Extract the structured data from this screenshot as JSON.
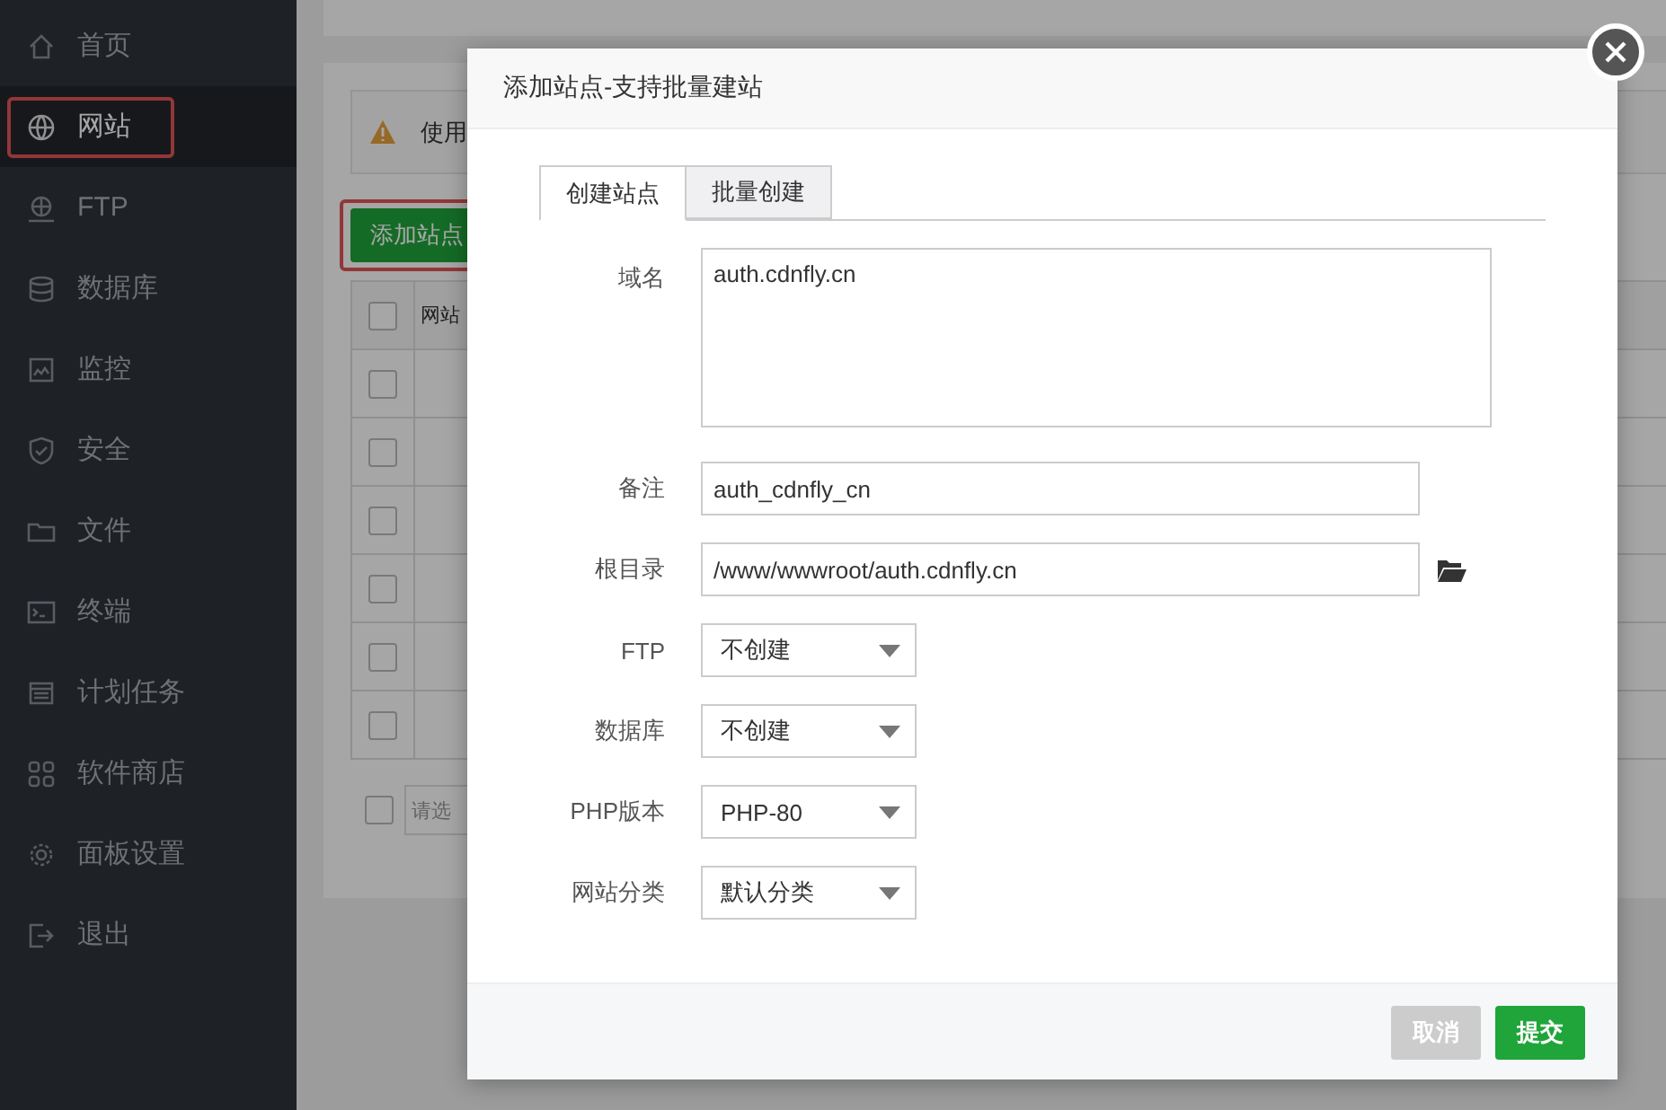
{
  "sidebar": {
    "items": [
      {
        "label": "首页",
        "selected": false
      },
      {
        "label": "网站",
        "selected": true
      },
      {
        "label": "FTP",
        "selected": false
      },
      {
        "label": "数据库",
        "selected": false
      },
      {
        "label": "监控",
        "selected": false
      },
      {
        "label": "安全",
        "selected": false
      },
      {
        "label": "文件",
        "selected": false
      },
      {
        "label": "终端",
        "selected": false
      },
      {
        "label": "计划任务",
        "selected": false
      },
      {
        "label": "软件商店",
        "selected": false
      },
      {
        "label": "面板设置",
        "selected": false
      },
      {
        "label": "退出",
        "selected": false
      }
    ]
  },
  "main": {
    "notice": {
      "text": "使用"
    },
    "add_button": {
      "label": "添加站点"
    },
    "table": {
      "header_checked": false,
      "columns": [
        "网站"
      ],
      "rows": [
        {
          "checked": false
        },
        {
          "checked": false
        },
        {
          "checked": false
        },
        {
          "checked": false
        },
        {
          "checked": false
        },
        {
          "checked": false
        }
      ]
    },
    "footer": {
      "checked": false,
      "select_placeholder": "请选"
    }
  },
  "modal": {
    "title": "添加站点-支持批量建站",
    "tabs": [
      {
        "label": "创建站点",
        "selected": true
      },
      {
        "label": "批量创建",
        "selected": false
      }
    ],
    "fields": [
      {
        "kind": "textarea",
        "label": "域名",
        "value": "auth.cdnfly.cn"
      },
      {
        "kind": "input",
        "label": "备注",
        "value": "auth_cdnfly_cn"
      },
      {
        "kind": "path",
        "label": "根目录",
        "value": "/www/wwwroot/auth.cdnfly.cn"
      },
      {
        "kind": "select",
        "label": "FTP",
        "value": "不创建"
      },
      {
        "kind": "select",
        "label": "数据库",
        "value": "不创建"
      },
      {
        "kind": "select",
        "label": "PHP版本",
        "value": "PHP-80"
      },
      {
        "kind": "select",
        "label": "网站分类",
        "value": "默认分类"
      }
    ],
    "buttons": [
      {
        "kind": "cancel",
        "label": "取消"
      },
      {
        "kind": "submit",
        "label": "提交"
      }
    ]
  }
}
